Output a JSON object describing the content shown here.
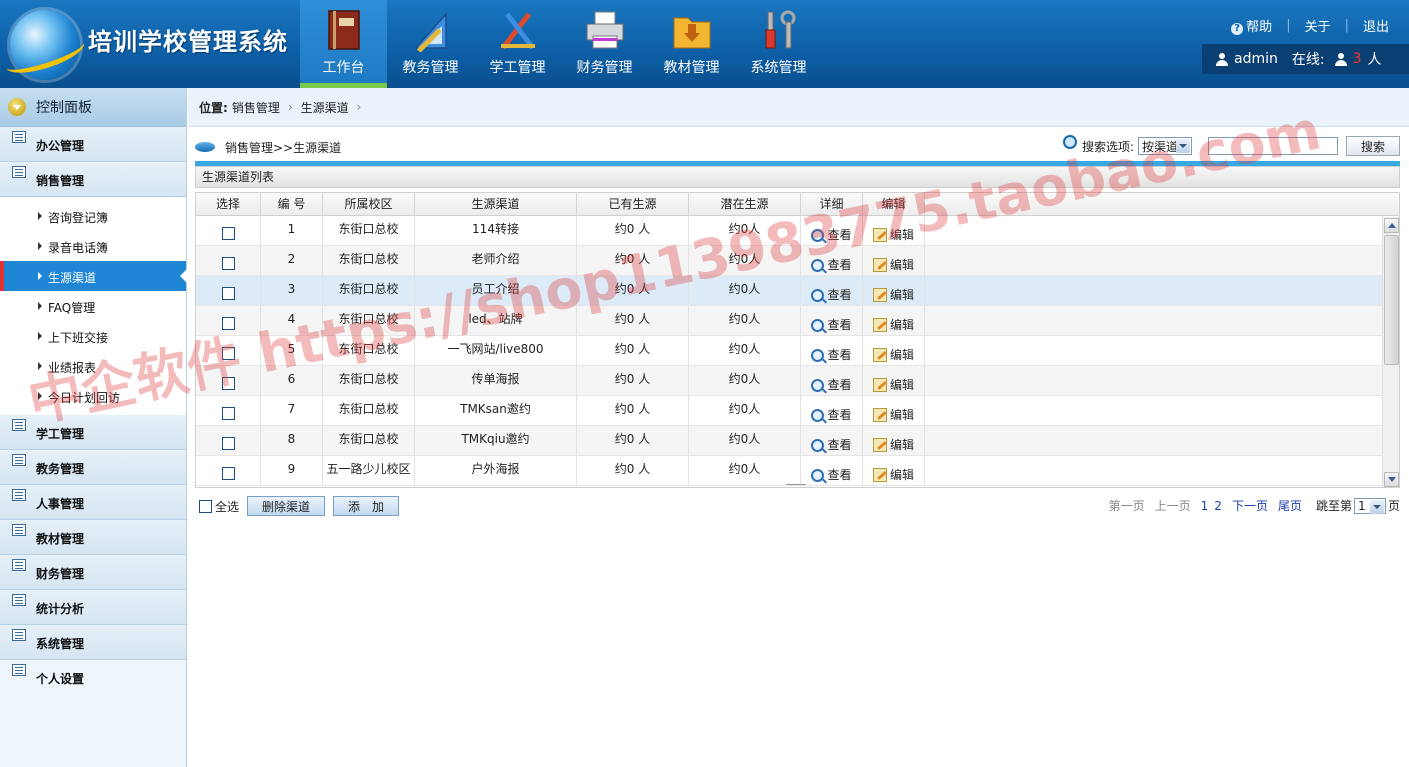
{
  "header": {
    "app_title": "培训学校管理系统",
    "nav": [
      {
        "label": "工作台",
        "icon": "book-icon",
        "active": true
      },
      {
        "label": "教务管理",
        "icon": "ruler-triangle-icon",
        "active": false
      },
      {
        "label": "学工管理",
        "icon": "drafting-tools-icon",
        "active": false
      },
      {
        "label": "财务管理",
        "icon": "printer-icon",
        "active": false
      },
      {
        "label": "教材管理",
        "icon": "folder-download-icon",
        "active": false
      },
      {
        "label": "系统管理",
        "icon": "tools-icon",
        "active": false
      }
    ],
    "links": {
      "help": "帮助",
      "about": "关于",
      "logout": "退出"
    },
    "user": {
      "name": "admin",
      "online_label": "在线:",
      "online_count": "3",
      "online_unit": "人"
    }
  },
  "sidebar": {
    "control_panel": "控制面板",
    "groups": [
      {
        "label": "办公管理"
      },
      {
        "label": "销售管理",
        "items": [
          {
            "label": "咨询登记簿",
            "active": false
          },
          {
            "label": "录音电话簿",
            "active": false
          },
          {
            "label": "生源渠道",
            "active": true
          },
          {
            "label": "FAQ管理",
            "active": false
          },
          {
            "label": "上下班交接",
            "active": false
          },
          {
            "label": "业绩报表",
            "active": false
          },
          {
            "label": "今日计划回访",
            "active": false
          }
        ]
      },
      {
        "label": "学工管理"
      },
      {
        "label": "教务管理"
      },
      {
        "label": "人事管理"
      },
      {
        "label": "教材管理"
      },
      {
        "label": "财务管理"
      },
      {
        "label": "统计分析"
      },
      {
        "label": "系统管理"
      },
      {
        "label": "个人设置"
      }
    ]
  },
  "breadcrumb": {
    "prefix": "位置:",
    "items": [
      "销售管理",
      "生源渠道"
    ],
    "chevron": "›"
  },
  "page": {
    "title": "销售管理>>生源渠道",
    "search": {
      "label": "搜索选项:",
      "option": "按渠道",
      "value": "",
      "button": "搜索"
    },
    "list_title": "生源渠道列表",
    "columns": [
      "选择",
      "编 号",
      "所属校区",
      "生源渠道",
      "已有生源",
      "潜在生源",
      "详细",
      "编辑"
    ],
    "rows": [
      {
        "id": "1",
        "campus": "东街口总校",
        "channel": "114转接",
        "existing": "约0 人",
        "potential": "约0人"
      },
      {
        "id": "2",
        "campus": "东街口总校",
        "channel": "老师介绍",
        "existing": "约0 人",
        "potential": "约0人"
      },
      {
        "id": "3",
        "campus": "东街口总校",
        "channel": "员工介绍",
        "existing": "约0 人",
        "potential": "约0人"
      },
      {
        "id": "4",
        "campus": "东街口总校",
        "channel": "led、站牌",
        "existing": "约0 人",
        "potential": "约0人"
      },
      {
        "id": "5",
        "campus": "东街口总校",
        "channel": "一飞网站/live800",
        "existing": "约0 人",
        "potential": "约0人"
      },
      {
        "id": "6",
        "campus": "东街口总校",
        "channel": "传单海报",
        "existing": "约0 人",
        "potential": "约0人"
      },
      {
        "id": "7",
        "campus": "东街口总校",
        "channel": "TMKsan邀约",
        "existing": "约0 人",
        "potential": "约0人"
      },
      {
        "id": "8",
        "campus": "东街口总校",
        "channel": "TMKqiu邀约",
        "existing": "约0 人",
        "potential": "约0人"
      },
      {
        "id": "9",
        "campus": "五一路少儿校区",
        "channel": "户外海报",
        "existing": "约0 人",
        "potential": "约0人"
      }
    ],
    "view_label": "查看",
    "edit_label": "编辑",
    "select_all": "全选",
    "delete_button": "删除渠道",
    "add_button": "添　加",
    "pager": {
      "first": "第一页",
      "prev": "上一页",
      "pages": [
        "1",
        "2"
      ],
      "next": "下一页",
      "last": "尾页",
      "jump_label": "跳至第",
      "jump_value": "1",
      "jump_suffix": "页"
    }
  },
  "watermark": "中企软件 https://shop113983775.taobao.com"
}
